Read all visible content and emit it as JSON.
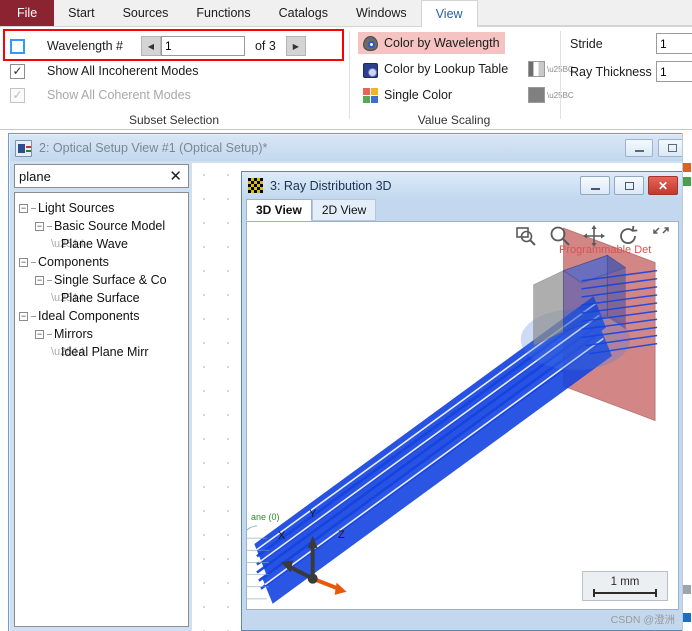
{
  "ribbon": {
    "tabs": [
      {
        "label": "File",
        "active": false,
        "kind": "file"
      },
      {
        "label": "Start",
        "active": false,
        "kind": "normal"
      },
      {
        "label": "Sources",
        "active": false,
        "kind": "normal"
      },
      {
        "label": "Functions",
        "active": false,
        "kind": "normal"
      },
      {
        "label": "Catalogs",
        "active": false,
        "kind": "normal"
      },
      {
        "label": "Windows",
        "active": false,
        "kind": "normal"
      },
      {
        "label": "View",
        "active": true,
        "kind": "normal"
      }
    ],
    "subset": {
      "caption": "Subset Selection",
      "wavelength_label": "Wavelength #",
      "wavelength_value": "1",
      "wavelength_of": "of 3",
      "prev_glyph": "◀",
      "next_glyph": "▶",
      "wavelength_checked": false,
      "incoherent_label": "Show All Incoherent Modes",
      "incoherent_checked": true,
      "coherent_label": "Show All Coherent Modes",
      "coherent_checked": true,
      "coherent_disabled": true
    },
    "value_scaling": {
      "caption": "Value Scaling",
      "items": [
        {
          "label": "Color by Wavelength",
          "icon": "eye-icon",
          "highlighted": true,
          "swatch": "none"
        },
        {
          "label": "Color by Lookup Table",
          "icon": "camera-icon",
          "highlighted": false,
          "swatch": "gradient"
        },
        {
          "label": "Single Color",
          "icon": "color-squares-icon",
          "highlighted": false,
          "swatch": "solid"
        }
      ]
    },
    "stride": {
      "stride_label": "Stride",
      "stride_value": "1",
      "thickness_label": "Ray Thickness",
      "thickness_value": "1"
    }
  },
  "optical_setup_window": {
    "title": "2: Optical Setup View #1 (Optical Setup)*",
    "minimize_glyph": "",
    "maximize_glyph": "",
    "search_value": "plane",
    "search_clear_glyph": "✕",
    "tree": [
      {
        "label": "Light Sources",
        "depth": 0,
        "expander": "−"
      },
      {
        "label": "Basic Source Model",
        "depth": 1,
        "expander": "−"
      },
      {
        "label": "Plane Wave",
        "depth": 2,
        "expander": ""
      },
      {
        "label": "Components",
        "depth": 0,
        "expander": "−"
      },
      {
        "label": "Single Surface & Co",
        "depth": 1,
        "expander": "−"
      },
      {
        "label": "Plane Surface",
        "depth": 2,
        "expander": ""
      },
      {
        "label": "Ideal Components",
        "depth": 0,
        "expander": "−"
      },
      {
        "label": "Mirrors",
        "depth": 1,
        "expander": "−"
      },
      {
        "label": "Ideal Plane Mirr",
        "depth": 2,
        "expander": ""
      }
    ]
  },
  "ray_window": {
    "title": "3: Ray Distribution 3D",
    "close_glyph": "✕",
    "tabs": [
      {
        "label": "3D View",
        "active": true
      },
      {
        "label": "2D View",
        "active": false
      }
    ],
    "toolbar": [
      {
        "name": "zoom-region-icon"
      },
      {
        "name": "magnifier-icon"
      },
      {
        "name": "pan-move-icon"
      },
      {
        "name": "rotate-icon"
      },
      {
        "name": "expand-icon"
      }
    ],
    "scene": {
      "detector_label": "Programmable Det",
      "source_label": "ane (0)",
      "axis_x": "X",
      "axis_y": "Y",
      "axis_z": "Z",
      "ray_color": "#1544e0",
      "detector_color": "#d08080",
      "cube_color": "#2a52c8",
      "scale_value": "1 mm"
    },
    "watermark": "CSDN @澄洲"
  }
}
